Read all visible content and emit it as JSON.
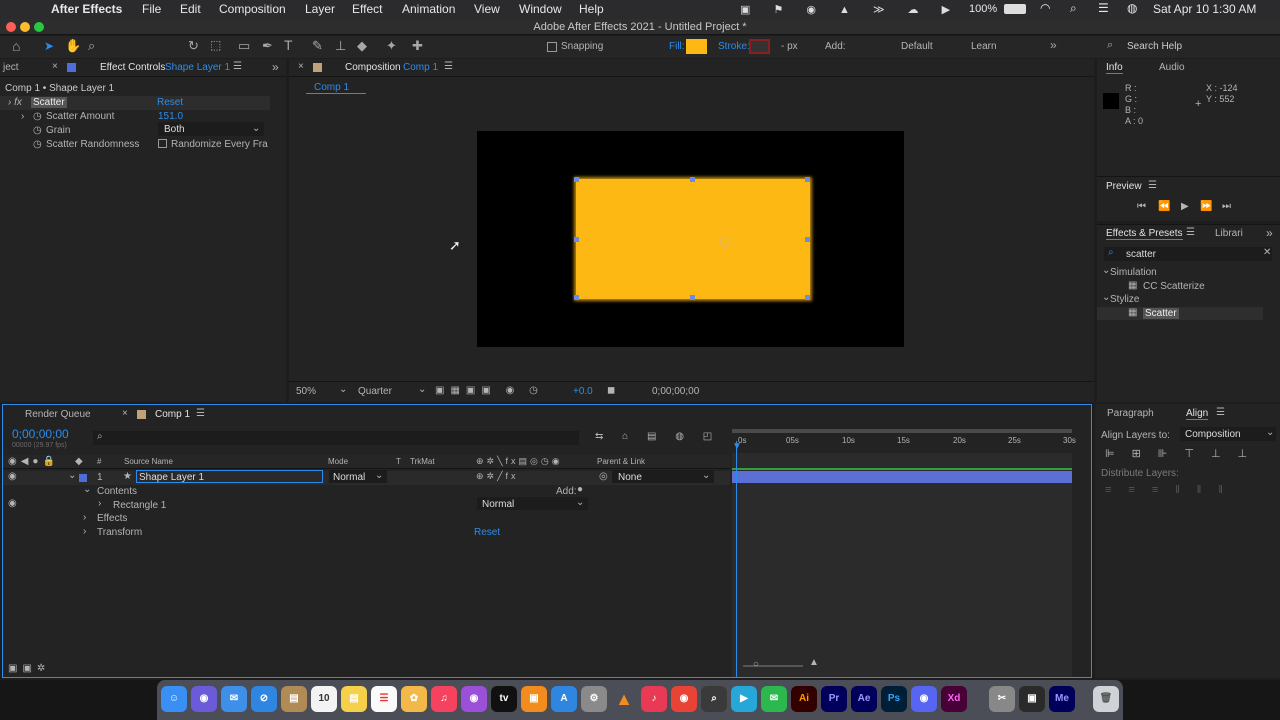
{
  "menubar": {
    "app_name": "After Effects",
    "items": [
      "File",
      "Edit",
      "Composition",
      "Layer",
      "Effect",
      "Animation",
      "View",
      "Window",
      "Help"
    ],
    "battery": "100%",
    "datetime": "Sat Apr 10  1:30 AM"
  },
  "window": {
    "title": "Adobe After Effects 2021 - Untitled Project *"
  },
  "toolbar": {
    "snapping": "Snapping",
    "fill": "Fill:",
    "stroke": "Stroke:",
    "stroke_unit": "- px",
    "add": "Add:",
    "workspace_default": "Default",
    "workspace_learn": "Learn",
    "search_help": "Search Help",
    "fill_color": "#fdb813"
  },
  "effect_controls": {
    "tab_project": "ject",
    "tab_label": "Effect Controls",
    "tab_layer": "Shape Layer 1",
    "breadcrumb": "Comp 1 • Shape Layer 1",
    "effect_name": "Scatter",
    "reset": "Reset",
    "props": [
      {
        "name": "Scatter Amount",
        "value": "151.0"
      },
      {
        "name": "Grain",
        "value": "Both"
      },
      {
        "name": "Scatter Randomness",
        "value": "Randomize Every Fra"
      }
    ]
  },
  "composition": {
    "tab_label": "Composition",
    "tab_comp": "Comp 1",
    "breadcrumb_tab": "Comp 1",
    "zoom": "50%",
    "resolution": "Quarter",
    "exposure": "+0.0",
    "timecode": "0;00;00;00",
    "shape_color": "#fdb813"
  },
  "info": {
    "tab_info": "Info",
    "tab_audio": "Audio",
    "r": "R :",
    "g": "G :",
    "b": "B :",
    "a": "A :  0",
    "x": "X : -124",
    "y": "Y :  552"
  },
  "preview": {
    "title": "Preview"
  },
  "effects_presets": {
    "tab_label": "Effects & Presets",
    "tab_libraries": "Librari",
    "search_value": "scatter",
    "groups": [
      {
        "name": "Simulation",
        "item": "CC Scatterize"
      },
      {
        "name": "Stylize",
        "item": "Scatter"
      }
    ]
  },
  "timeline": {
    "tab_render": "Render Queue",
    "tab_comp": "Comp 1",
    "timecode": "0;00;00;00",
    "frames": "00000 (29.97 fps)",
    "col_source": "Source Name",
    "col_mode": "Mode",
    "col_t": "T",
    "col_trkmat": "TrkMat",
    "col_parent": "Parent & Link",
    "layer_num": "1",
    "layer_name": "Shape Layer 1",
    "layer_mode": "Normal",
    "parent": "None",
    "contents": "Contents",
    "add": "Add:",
    "rect": "Rectangle 1",
    "rect_mode": "Normal",
    "effects": "Effects",
    "transform": "Transform",
    "reset": "Reset",
    "ruler": [
      "0s",
      "05s",
      "10s",
      "15s",
      "20s",
      "25s",
      "30s"
    ]
  },
  "align": {
    "tab_paragraph": "Paragraph",
    "tab_align": "Align",
    "align_to_label": "Align Layers to:",
    "align_to_value": "Composition",
    "distribute": "Distribute Layers:"
  },
  "dock": {
    "apps": [
      "finder",
      "siri",
      "mail",
      "safari",
      "notes",
      "calendar",
      "stickies",
      "reminders",
      "photos",
      "music",
      "podcasts",
      "tv",
      "books",
      "appstore",
      "prefs",
      "vlc",
      "itunes",
      "chrome",
      "alfred",
      "infuse",
      "messages",
      "illustrator",
      "premiere",
      "aftereffects",
      "photoshop",
      "discord",
      "xd",
      "toolbox",
      "screen",
      "media-encoder",
      "trash"
    ],
    "calendar_day": "10",
    "ai": "Ai",
    "pr": "Pr",
    "ae": "Ae",
    "ps": "Ps",
    "xd": "Xd",
    "me": "Me"
  }
}
